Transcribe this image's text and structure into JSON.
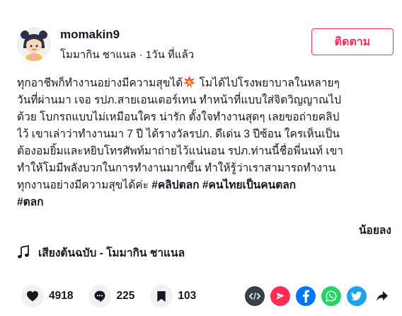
{
  "author": {
    "username": "momakin9",
    "display_name": "โมมากิน ชาแนล",
    "separator": "·",
    "posted_ago": "1วัน ที่แล้ว"
  },
  "follow_button": {
    "label": "ติดตาม"
  },
  "caption": {
    "line1_a": "ทุกอาชีพก็ทำงานอย่างมีความสุขได้",
    "emoji": "collision-emoji",
    "line1_b": " โมได้ไปโรงพยาบาลในหลายๆ",
    "line2": "วันที่ผ่านมา เจอ รปภ.สายเอนเตอร์เทน ทำหน้าที่แบบใส่จิตวิญญาณไป",
    "line3": "ด้วย โบกรถแบบไม่เหมือนใคร น่ารัก ตั้งใจทำงานสุดๆ เลยขอถ่ายคลิป",
    "line4": "ไว้ เขาเล่าว่าทำงานมา 7 ปี ได้รางวัลรปภ. ดีเด่น 3 ปีซ้อน ใครเห็นเป็น",
    "line5": "ต้องอมยิ้มและหยิบโทรศัพท์มาถ่ายไว้แน่นอน รปภ.ท่านนี้ชื่อพี่นนท์ เขา",
    "line6": "ทำให้โมมีพลังบวกในการทำงานมากขึ้น ทำให้รู้ว่าเราสามารถทำงาน",
    "line7_text": "ทุกงานอย่างมีความสุขได้ค่ะ ",
    "hashtags": [
      "#คลิปตลก",
      "#คนไทยเป็นคนตลก",
      "#ตลก"
    ]
  },
  "see_less": "น้อยลง",
  "music": {
    "title": "เสียงต้นฉบับ - โมมากิน ชาแนล",
    "icon": "music-note-icon"
  },
  "stats": {
    "likes": "4918",
    "comments": "225",
    "saves": "103"
  },
  "share_icons": [
    "embed-icon",
    "send-icon",
    "facebook-icon",
    "whatsapp-icon",
    "twitter-icon",
    "share-arrow-icon"
  ],
  "colors": {
    "accent": "#fe2c55",
    "text": "#161823",
    "stat_bg": "#f1f1f2",
    "embed": "#383f46",
    "send": "#fe2c55",
    "facebook": "#0075fa",
    "whatsapp": "#25d366",
    "twitter": "#1da1f2"
  }
}
